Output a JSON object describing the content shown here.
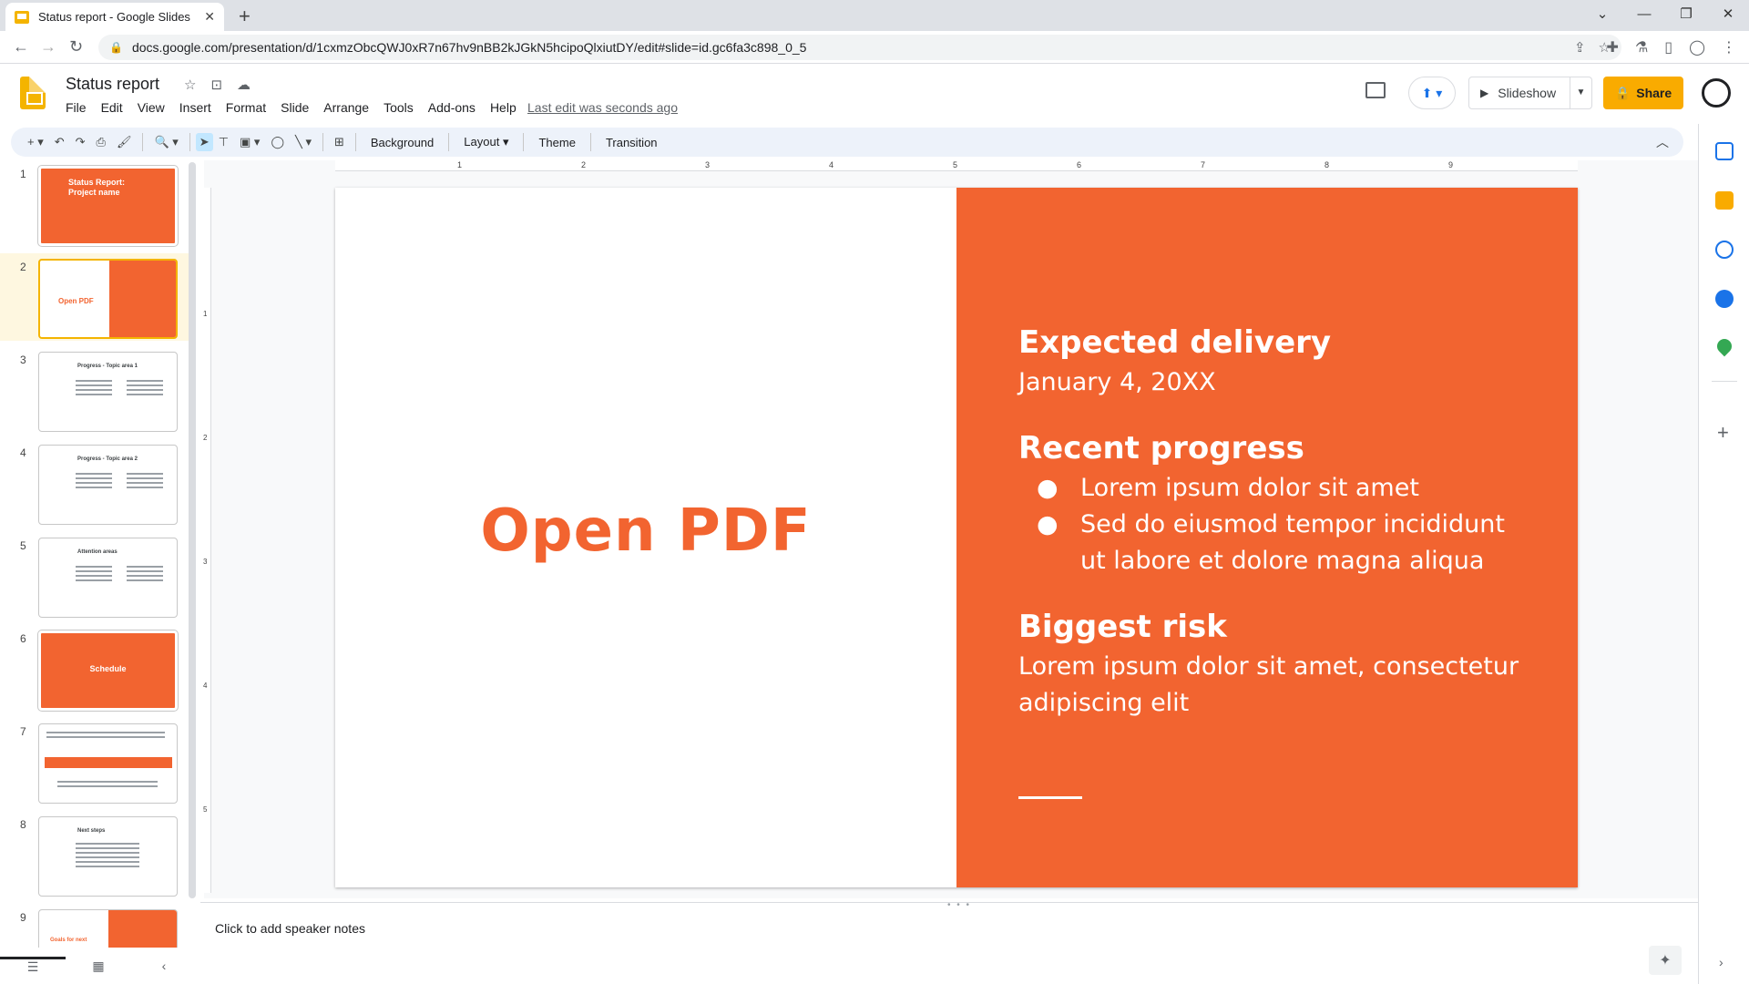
{
  "browser": {
    "tab_title": "Status report - Google Slides",
    "url": "docs.google.com/presentation/d/1cxmzObcQWJ0xR7n67hv9nBB2kJGkN5hcipoQlxiutDY/edit#slide=id.gc6fa3c898_0_5"
  },
  "app": {
    "doc_title": "Status report",
    "last_edit": "Last edit was seconds ago",
    "menu": [
      "File",
      "Edit",
      "View",
      "Insert",
      "Format",
      "Slide",
      "Arrange",
      "Tools",
      "Add-ons",
      "Help"
    ],
    "slideshow_label": "Slideshow",
    "share_label": "Share"
  },
  "toolbar": {
    "background": "Background",
    "layout": "Layout",
    "theme": "Theme",
    "transition": "Transition"
  },
  "filmstrip": {
    "numbers": [
      "1",
      "2",
      "3",
      "4",
      "5",
      "6",
      "7",
      "8",
      "9"
    ],
    "slide1_title": "Status Report: Project name",
    "slide2_title": "Open PDF",
    "slide3_title": "Progress - Topic area 1",
    "slide4_title": "Progress - Topic area 2",
    "slide5_title": "Attention areas",
    "slide6_title": "Schedule",
    "slide8_title": "Next steps",
    "slide9_title": "Goals for next"
  },
  "slide": {
    "left_title": "Open PDF",
    "h1": "Expected delivery",
    "t1": "January 4, 20XX",
    "h2": "Recent progress",
    "b1": "Lorem ipsum dolor sit amet",
    "b2": "Sed do eiusmod tempor incididunt ut labore et dolore magna aliqua",
    "h3": "Biggest risk",
    "t3": "Lorem ipsum dolor sit amet, consectetur adipiscing elit",
    "accent_color": "#F26430"
  },
  "ruler": {
    "top": [
      "1",
      "2",
      "3",
      "4",
      "5",
      "6",
      "7",
      "8",
      "9"
    ],
    "left": [
      "1",
      "2",
      "3",
      "4",
      "5"
    ]
  },
  "notes": {
    "placeholder": "Click to add speaker notes"
  }
}
